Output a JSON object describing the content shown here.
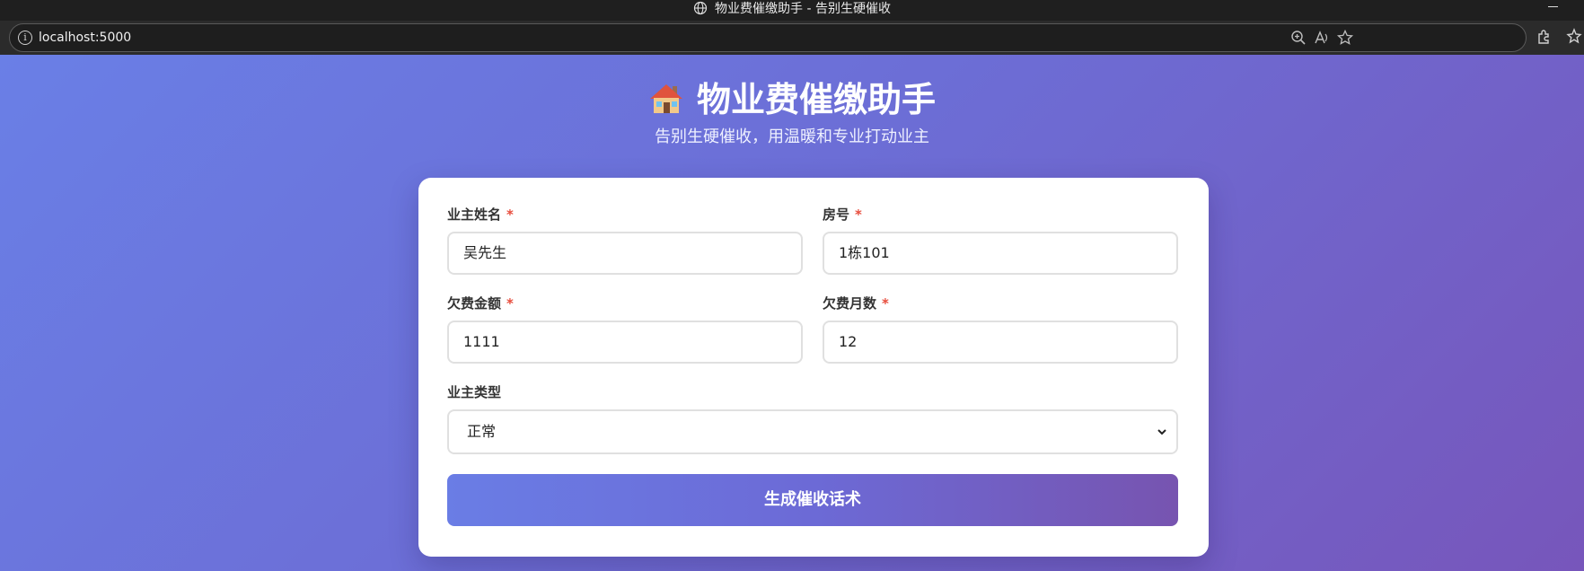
{
  "window": {
    "title": "物业费催缴助手 - 告别生硬催收"
  },
  "browser": {
    "url": "localhost:5000",
    "icons": [
      "globe-icon",
      "info-icon",
      "zoom-icon",
      "read-aloud-icon",
      "favorite-star-icon",
      "extensions-icon",
      "favorites-icon"
    ]
  },
  "header": {
    "emoji_icon": "house-icon",
    "title": "物业费催缴助手",
    "subtitle": "告别生硬催收，用温暖和专业打动业主"
  },
  "form": {
    "required_mark": "*",
    "owner_name": {
      "label": "业主姓名",
      "value": "吴先生"
    },
    "room_number": {
      "label": "房号",
      "value": "1栋101"
    },
    "arrears_amount": {
      "label": "欠费金额",
      "value": "1111"
    },
    "arrears_months": {
      "label": "欠费月数",
      "value": "12"
    },
    "owner_type": {
      "label": "业主类型",
      "value": "正常"
    },
    "submit_label": "生成催收话术"
  },
  "colors": {
    "gradient_start": "#6a7fe6",
    "gradient_end": "#7756bb",
    "required": "#e74c3c"
  }
}
